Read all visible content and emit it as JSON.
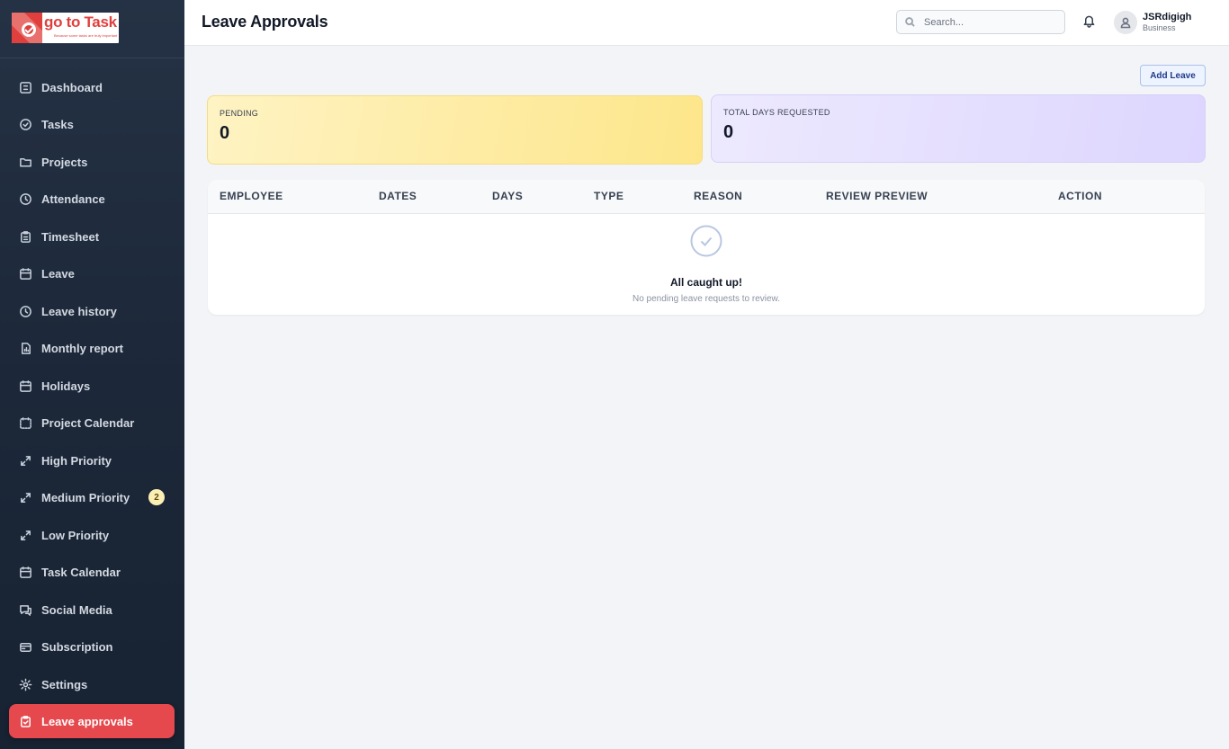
{
  "brand": {
    "logo_text": "go to Task",
    "tagline": "Because some tasks are truly important"
  },
  "header": {
    "title": "Leave Approvals",
    "search_placeholder": "Search...",
    "user_name": "JSRdigigh",
    "user_role": "Business"
  },
  "sidebar": {
    "items": [
      {
        "label": "Dashboard",
        "icon": "dashboard-icon"
      },
      {
        "label": "Tasks",
        "icon": "check-circle-icon"
      },
      {
        "label": "Projects",
        "icon": "folder-icon"
      },
      {
        "label": "Attendance",
        "icon": "clock-icon"
      },
      {
        "label": "Timesheet",
        "icon": "clipboard-icon"
      },
      {
        "label": "Leave",
        "icon": "calendar-icon"
      },
      {
        "label": "Leave history",
        "icon": "clock-icon"
      },
      {
        "label": "Monthly report",
        "icon": "report-icon"
      },
      {
        "label": "Holidays",
        "icon": "calendar-icon"
      },
      {
        "label": "Project Calendar",
        "icon": "calendar-dashed-icon"
      },
      {
        "label": "High Priority",
        "icon": "arrows-icon"
      },
      {
        "label": "Medium Priority",
        "icon": "arrows-icon",
        "badge": "2"
      },
      {
        "label": "Low Priority",
        "icon": "arrows-icon"
      },
      {
        "label": "Task Calendar",
        "icon": "calendar-icon"
      },
      {
        "label": "Social Media",
        "icon": "chat-icon"
      },
      {
        "label": "Subscription",
        "icon": "card-icon"
      },
      {
        "label": "Settings",
        "icon": "gear-icon"
      },
      {
        "label": "Leave approvals",
        "icon": "clipboard-check-icon",
        "active": true
      }
    ]
  },
  "main": {
    "add_leave_label": "Add Leave",
    "stats": {
      "pending_label": "PENDING",
      "pending_value": "0",
      "total_label": "TOTAL DAYS REQUESTED",
      "total_value": "0"
    },
    "table": {
      "columns": [
        "EMPLOYEE",
        "DATES",
        "DAYS",
        "TYPE",
        "REASON",
        "REVIEW PREVIEW",
        "ACTION"
      ],
      "empty_title": "All caught up!",
      "empty_subtitle": "No pending leave requests to review."
    }
  },
  "colors": {
    "sidebar_bg": "#1d293a",
    "active_item": "#e5484d",
    "pending_card": "#fde68a",
    "total_card": "#ddd6fe",
    "brand_red": "#e0403d"
  }
}
